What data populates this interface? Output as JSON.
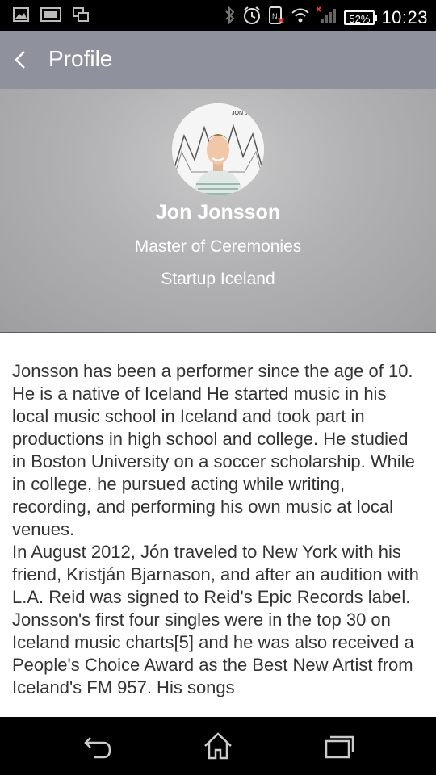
{
  "status_bar": {
    "battery": "52%",
    "time": "10:23"
  },
  "app_bar": {
    "title": "Profile"
  },
  "profile": {
    "avatar_text": "JÓN JÓN",
    "name": "Jon Jonsson",
    "role": "Master of Ceremonies",
    "organization": "Startup Iceland"
  },
  "bio": {
    "paragraphs": [
      "Jonsson has been a performer since the age of 10. He is a native of Iceland He started music in his local music school in Iceland and took part in productions in high school and college. He studied in Boston University on a soccer scholarship. While in college, he pursued acting while writing, recording, and performing his own music at local venues.",
      "In August 2012, Jón traveled to New York with his friend, Kristján Bjarnason, and after an audition with L.A. Reid was signed to Reid's Epic Records label.",
      "Jonsson's first four singles were in the top 30 on Iceland music charts[5] and he was also received a People's Choice Award as the Best New Artist from Iceland's FM 957. His songs"
    ]
  },
  "icons": {
    "status_left": [
      "image-notification-icon",
      "screenshot-notification-icon",
      "screen-mirror-icon"
    ],
    "status_right": [
      "bluetooth-icon",
      "alarm-icon",
      "nfc-icon",
      "wifi-icon",
      "signal-icon",
      "battery-icon"
    ],
    "nav": [
      "back-icon",
      "home-icon",
      "recent-apps-icon"
    ]
  },
  "colors": {
    "app_bar": "#8f929d",
    "status_bar": "#000000",
    "nav_bar": "#000000",
    "body_text": "#333333",
    "signal_alert": "#e53935"
  }
}
